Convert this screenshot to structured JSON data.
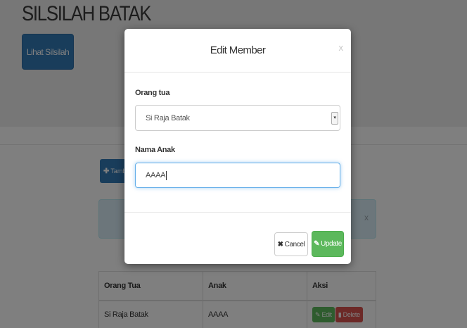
{
  "page": {
    "title": "SILSILAH BATAK",
    "lihat_button": "Lihat Silsilah",
    "tambah_button": "Tambah",
    "alert_close": "x"
  },
  "table": {
    "headers": [
      "Orang Tua",
      "Anak",
      "Aksi"
    ],
    "rows": [
      {
        "orang_tua": "Si Raja Batak",
        "anak": "AAAA",
        "edit_label": "Edit",
        "delete_label": "Delete"
      }
    ]
  },
  "modal": {
    "title": "Edit Member",
    "close": "x",
    "orang_tua_label": "Orang tua",
    "orang_tua_value": "Si Raja Batak",
    "nama_anak_label": "Nama Anak",
    "nama_anak_value": "AAAA",
    "cancel_label": "Cancel",
    "update_label": "Update"
  },
  "icons": {
    "tambah": "plus-icon",
    "cancel": "times-icon",
    "update": "edit-icon",
    "edit": "edit-icon",
    "delete": "trash-icon",
    "select": "chevron-down-icon"
  },
  "colors": {
    "primary": "#337ab7",
    "success": "#5cb85c",
    "danger": "#d9534f",
    "info_bg": "#d9edf7",
    "focus": "#66afe9"
  }
}
